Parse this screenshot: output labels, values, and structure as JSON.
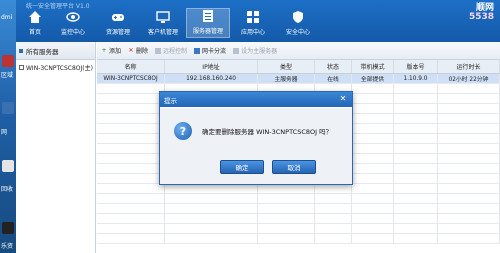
{
  "desktop": {
    "labels": [
      "dmi",
      "区域",
      "网",
      "回收",
      "乐资"
    ]
  },
  "app": {
    "title": "统一安全管理平台 V1.0"
  },
  "nav": {
    "items": [
      {
        "label": "首页",
        "icon": "home-icon"
      },
      {
        "label": "监控中心",
        "icon": "eye-icon"
      },
      {
        "label": "资源管理",
        "icon": "gamepad-icon"
      },
      {
        "label": "客户机管理",
        "icon": "monitor-icon"
      },
      {
        "label": "服务器管理",
        "icon": "server-doc-icon"
      },
      {
        "label": "应用中心",
        "icon": "grid-icon"
      },
      {
        "label": "安全中心",
        "icon": "shield-icon"
      }
    ],
    "active_index": 4,
    "brand_line1": "顺网",
    "brand_line2": "5538"
  },
  "tree": {
    "header": "所有服务器",
    "nodes": [
      "WIN-3CNPTCSC8OJ(主)"
    ]
  },
  "toolbar": {
    "add": "添加",
    "delete": "删除",
    "remote": "远程控制",
    "sync": "网卡分流",
    "set_master": "设为主服务器"
  },
  "table": {
    "headers": [
      "名称",
      "IP地址",
      "类型",
      "状态",
      "带机模式",
      "版本号",
      "运行时长"
    ],
    "rows": [
      [
        "WIN-3CNPTCSC8OJ",
        "192.168.160.240",
        "主服务器",
        "在线",
        "全部提供",
        "1.10.9.0",
        "02小时 22分钟"
      ]
    ]
  },
  "dialog": {
    "title": "提示",
    "message": "确定要删除服务器 WIN-3CNPTCSC8OJ 吗？",
    "ok": "确定",
    "cancel": "取消"
  },
  "colors": {
    "titlebar": "#1d6fc6",
    "selected_row": "#cfe0f6",
    "dialog_border": "#2a67b3"
  }
}
